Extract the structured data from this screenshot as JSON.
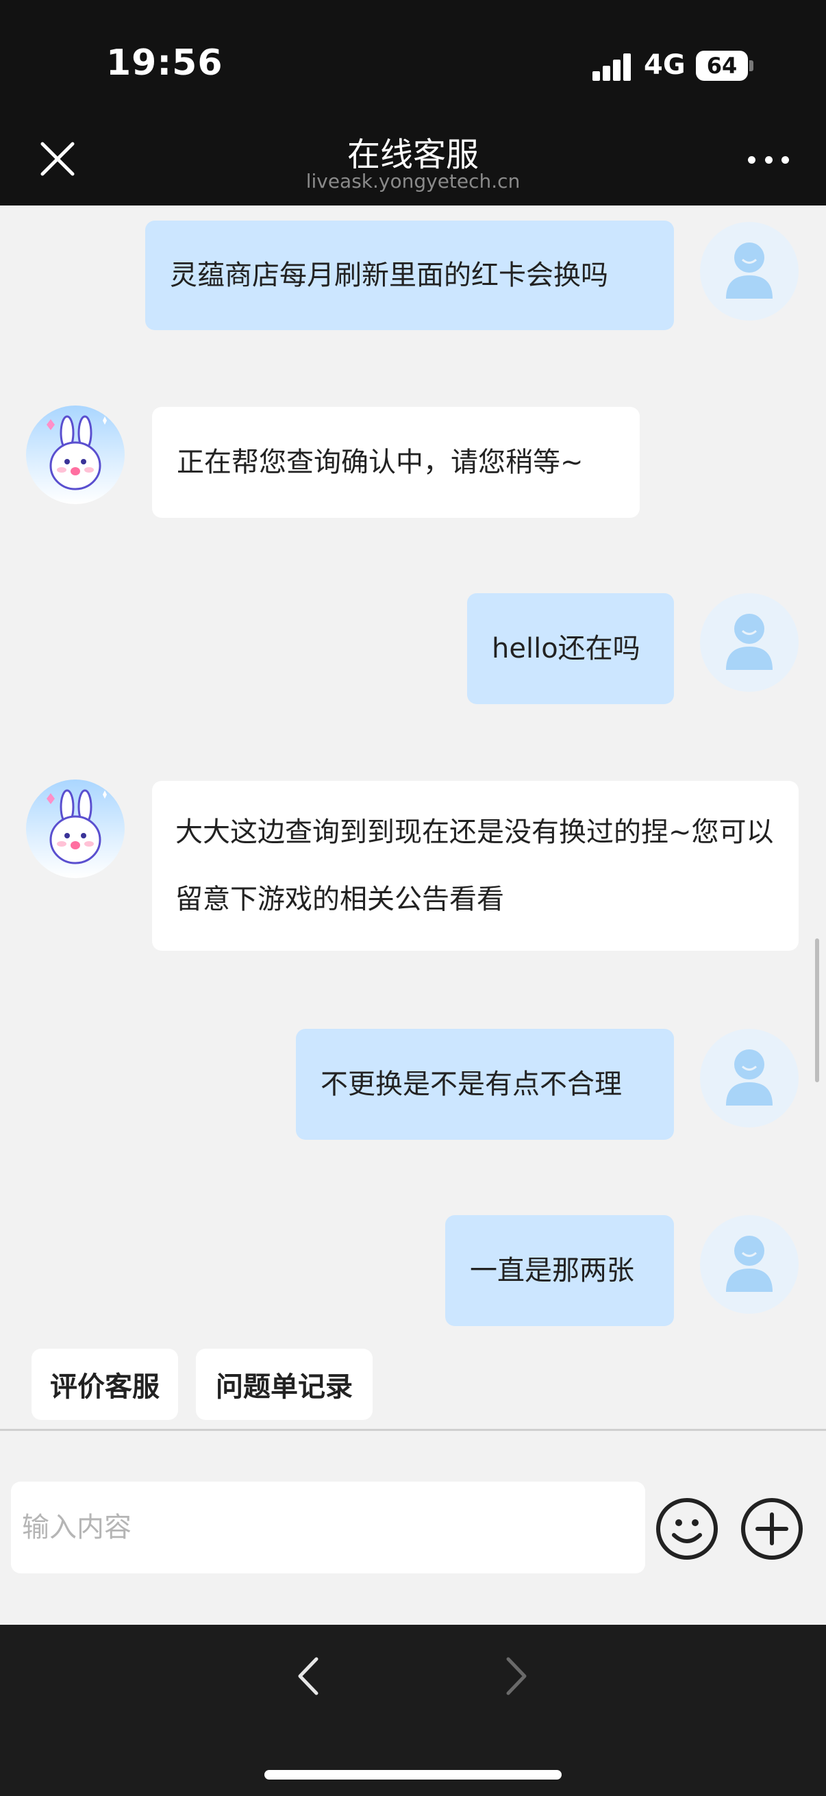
{
  "status_bar": {
    "time": "19:56",
    "network": "4G",
    "battery": "64"
  },
  "header": {
    "title": "在线客服",
    "subtitle": "liveask.yongyetech.cn"
  },
  "messages": [
    {
      "sender": "user",
      "text": "灵蕴商店每月刷新里面的红卡会换吗"
    },
    {
      "sender": "agent",
      "text": "正在帮您查询确认中，请您稍等~"
    },
    {
      "sender": "user",
      "text": "hello还在吗"
    },
    {
      "sender": "agent",
      "text": "大大这边查询到到现在还是没有换过的捏~您可以留意下游戏的相关公告看看"
    },
    {
      "sender": "user",
      "text": "不更换是不是有点不合理"
    },
    {
      "sender": "user",
      "text": "一直是那两张"
    }
  ],
  "quick_actions": [
    "评价客服",
    "问题单记录"
  ],
  "input": {
    "placeholder": "输入内容"
  },
  "icons": {
    "close": "close-icon",
    "more": "more-icon",
    "emoji": "emoji-icon",
    "plus": "plus-icon",
    "back": "chevron-left-icon",
    "forward": "chevron-right-icon"
  },
  "colors": {
    "user_bubble": "#cce6ff",
    "agent_bubble": "#ffffff",
    "header_bg": "#121212",
    "background": "#f2f2f2"
  }
}
